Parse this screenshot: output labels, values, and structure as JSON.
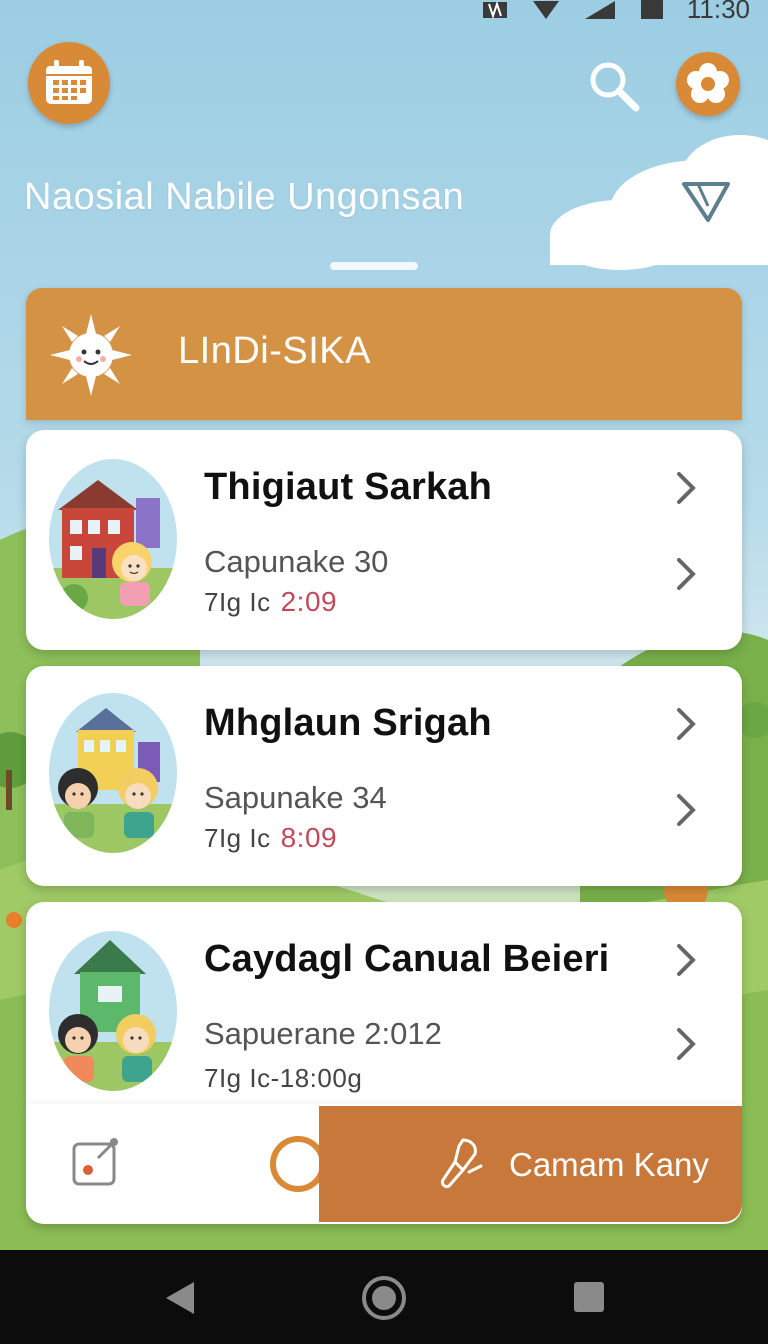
{
  "status_bar": {
    "time": "11:30"
  },
  "header": {
    "title": "Naosial Nabile Ungonsan",
    "calendar_icon": "calendar-icon",
    "search_icon": "search-icon",
    "settings_icon": "flower-settings-icon",
    "filter_icon": "filter-icon"
  },
  "section": {
    "title": "LInDi-SIKA",
    "icon": "sun-icon"
  },
  "cards": [
    {
      "name": "Thigiaut Sarkah",
      "subtitle": "Capunake 30",
      "meta_label": "7Ig Ic",
      "time": "2:09"
    },
    {
      "name": "Mhglaun Srigah",
      "subtitle": "Sapunake 34",
      "meta_label": "7Ig Ic",
      "time": "8:09"
    },
    {
      "name": "Caydagl Canual Beieri",
      "subtitle": "Sapuerane 2:012",
      "meta_label": "7Ig Ic-18:00g",
      "time": ""
    }
  ],
  "action_bar": {
    "cta_label": "Camam Kany",
    "cta_icon": "brush-icon",
    "edit_icon": "edit-icon"
  },
  "colors": {
    "accent": "#d98a36",
    "cta": "#c8783a",
    "time": "#c24a5a",
    "sky": "#9ccde3"
  }
}
